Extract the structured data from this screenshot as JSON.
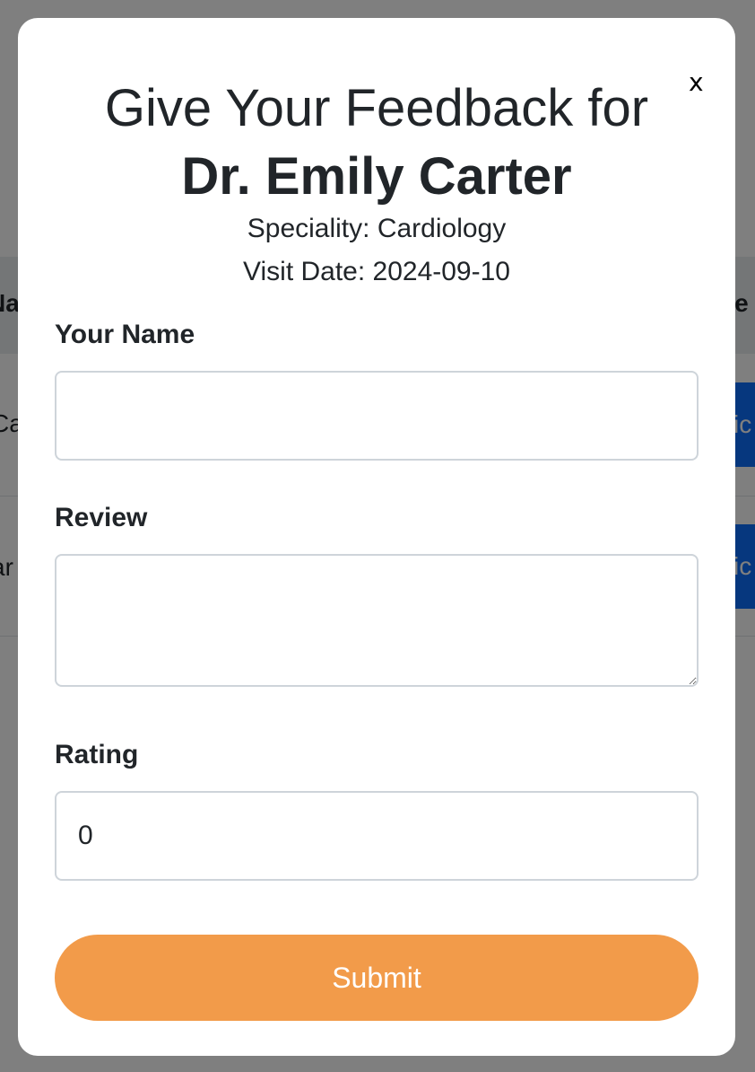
{
  "background": {
    "header_left": "Na",
    "header_right": "de",
    "row1_text": "Ca",
    "row2_text": "ar",
    "row_button_label": "vic"
  },
  "modal": {
    "close_label": "x",
    "title_prefix": "Give Your Feedback for",
    "doctor_name": "Dr. Emily Carter",
    "speciality": "Speciality: Cardiology",
    "visit_date": "Visit Date: 2024-09-10",
    "form": {
      "name_label": "Your Name",
      "name_value": "",
      "review_label": "Review",
      "review_value": "",
      "rating_label": "Rating",
      "rating_value": "0",
      "submit_label": "Submit"
    }
  },
  "colors": {
    "accent": "#f29b4a",
    "overlay": "rgba(0,0,0,0.5)"
  }
}
